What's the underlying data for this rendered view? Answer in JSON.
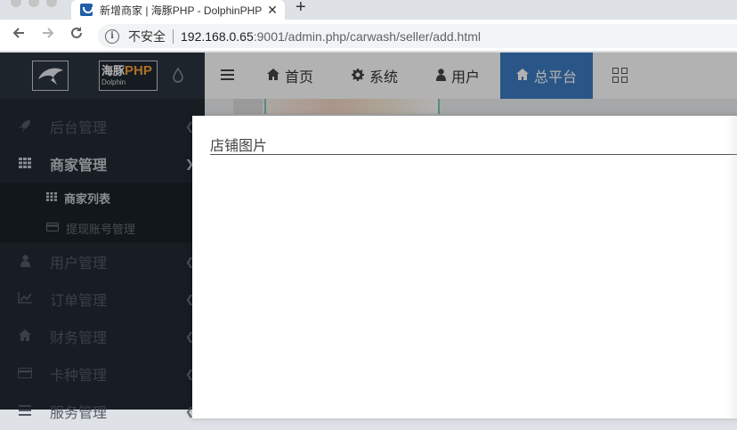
{
  "browser": {
    "tab_title": "新增商家 | 海豚PHP - DolphinPHP",
    "tab_close": "✕",
    "new_tab": "+",
    "security_label": "不安全",
    "url_host": "192.168.0.65",
    "url_rest": ":9001/admin.php/carwash/seller/add.html"
  },
  "logo": {
    "text_cn": "海豚",
    "text_php": "PHP",
    "text_en": "Dolphin"
  },
  "topnav": {
    "items": [
      {
        "label": "首页",
        "icon": "home-icon"
      },
      {
        "label": "系统",
        "icon": "gear-icon"
      },
      {
        "label": "用户",
        "icon": "user-icon"
      },
      {
        "label": "总平台",
        "icon": "home-icon",
        "active": true
      }
    ]
  },
  "sidebar": {
    "items": [
      {
        "label": "后台管理",
        "icon": "rocket-icon"
      },
      {
        "label": "商家管理",
        "icon": "grid-icon",
        "open": true
      },
      {
        "label": "用户管理",
        "icon": "user-icon"
      },
      {
        "label": "订单管理",
        "icon": "chart-icon"
      },
      {
        "label": "财务管理",
        "icon": "home-icon"
      },
      {
        "label": "卡种管理",
        "icon": "card-icon"
      },
      {
        "label": "服务管理",
        "icon": "list-icon"
      }
    ],
    "subitems": [
      {
        "label": "商家列表",
        "icon": "grid-icon",
        "active": true
      },
      {
        "label": "提现账号管理",
        "icon": "card-icon"
      }
    ]
  },
  "modal": {
    "title": "店铺图片"
  },
  "colors": {
    "accent": "#3d7cc2",
    "sidebar_bg": "#222a33",
    "logo_php": "#f7a035"
  }
}
